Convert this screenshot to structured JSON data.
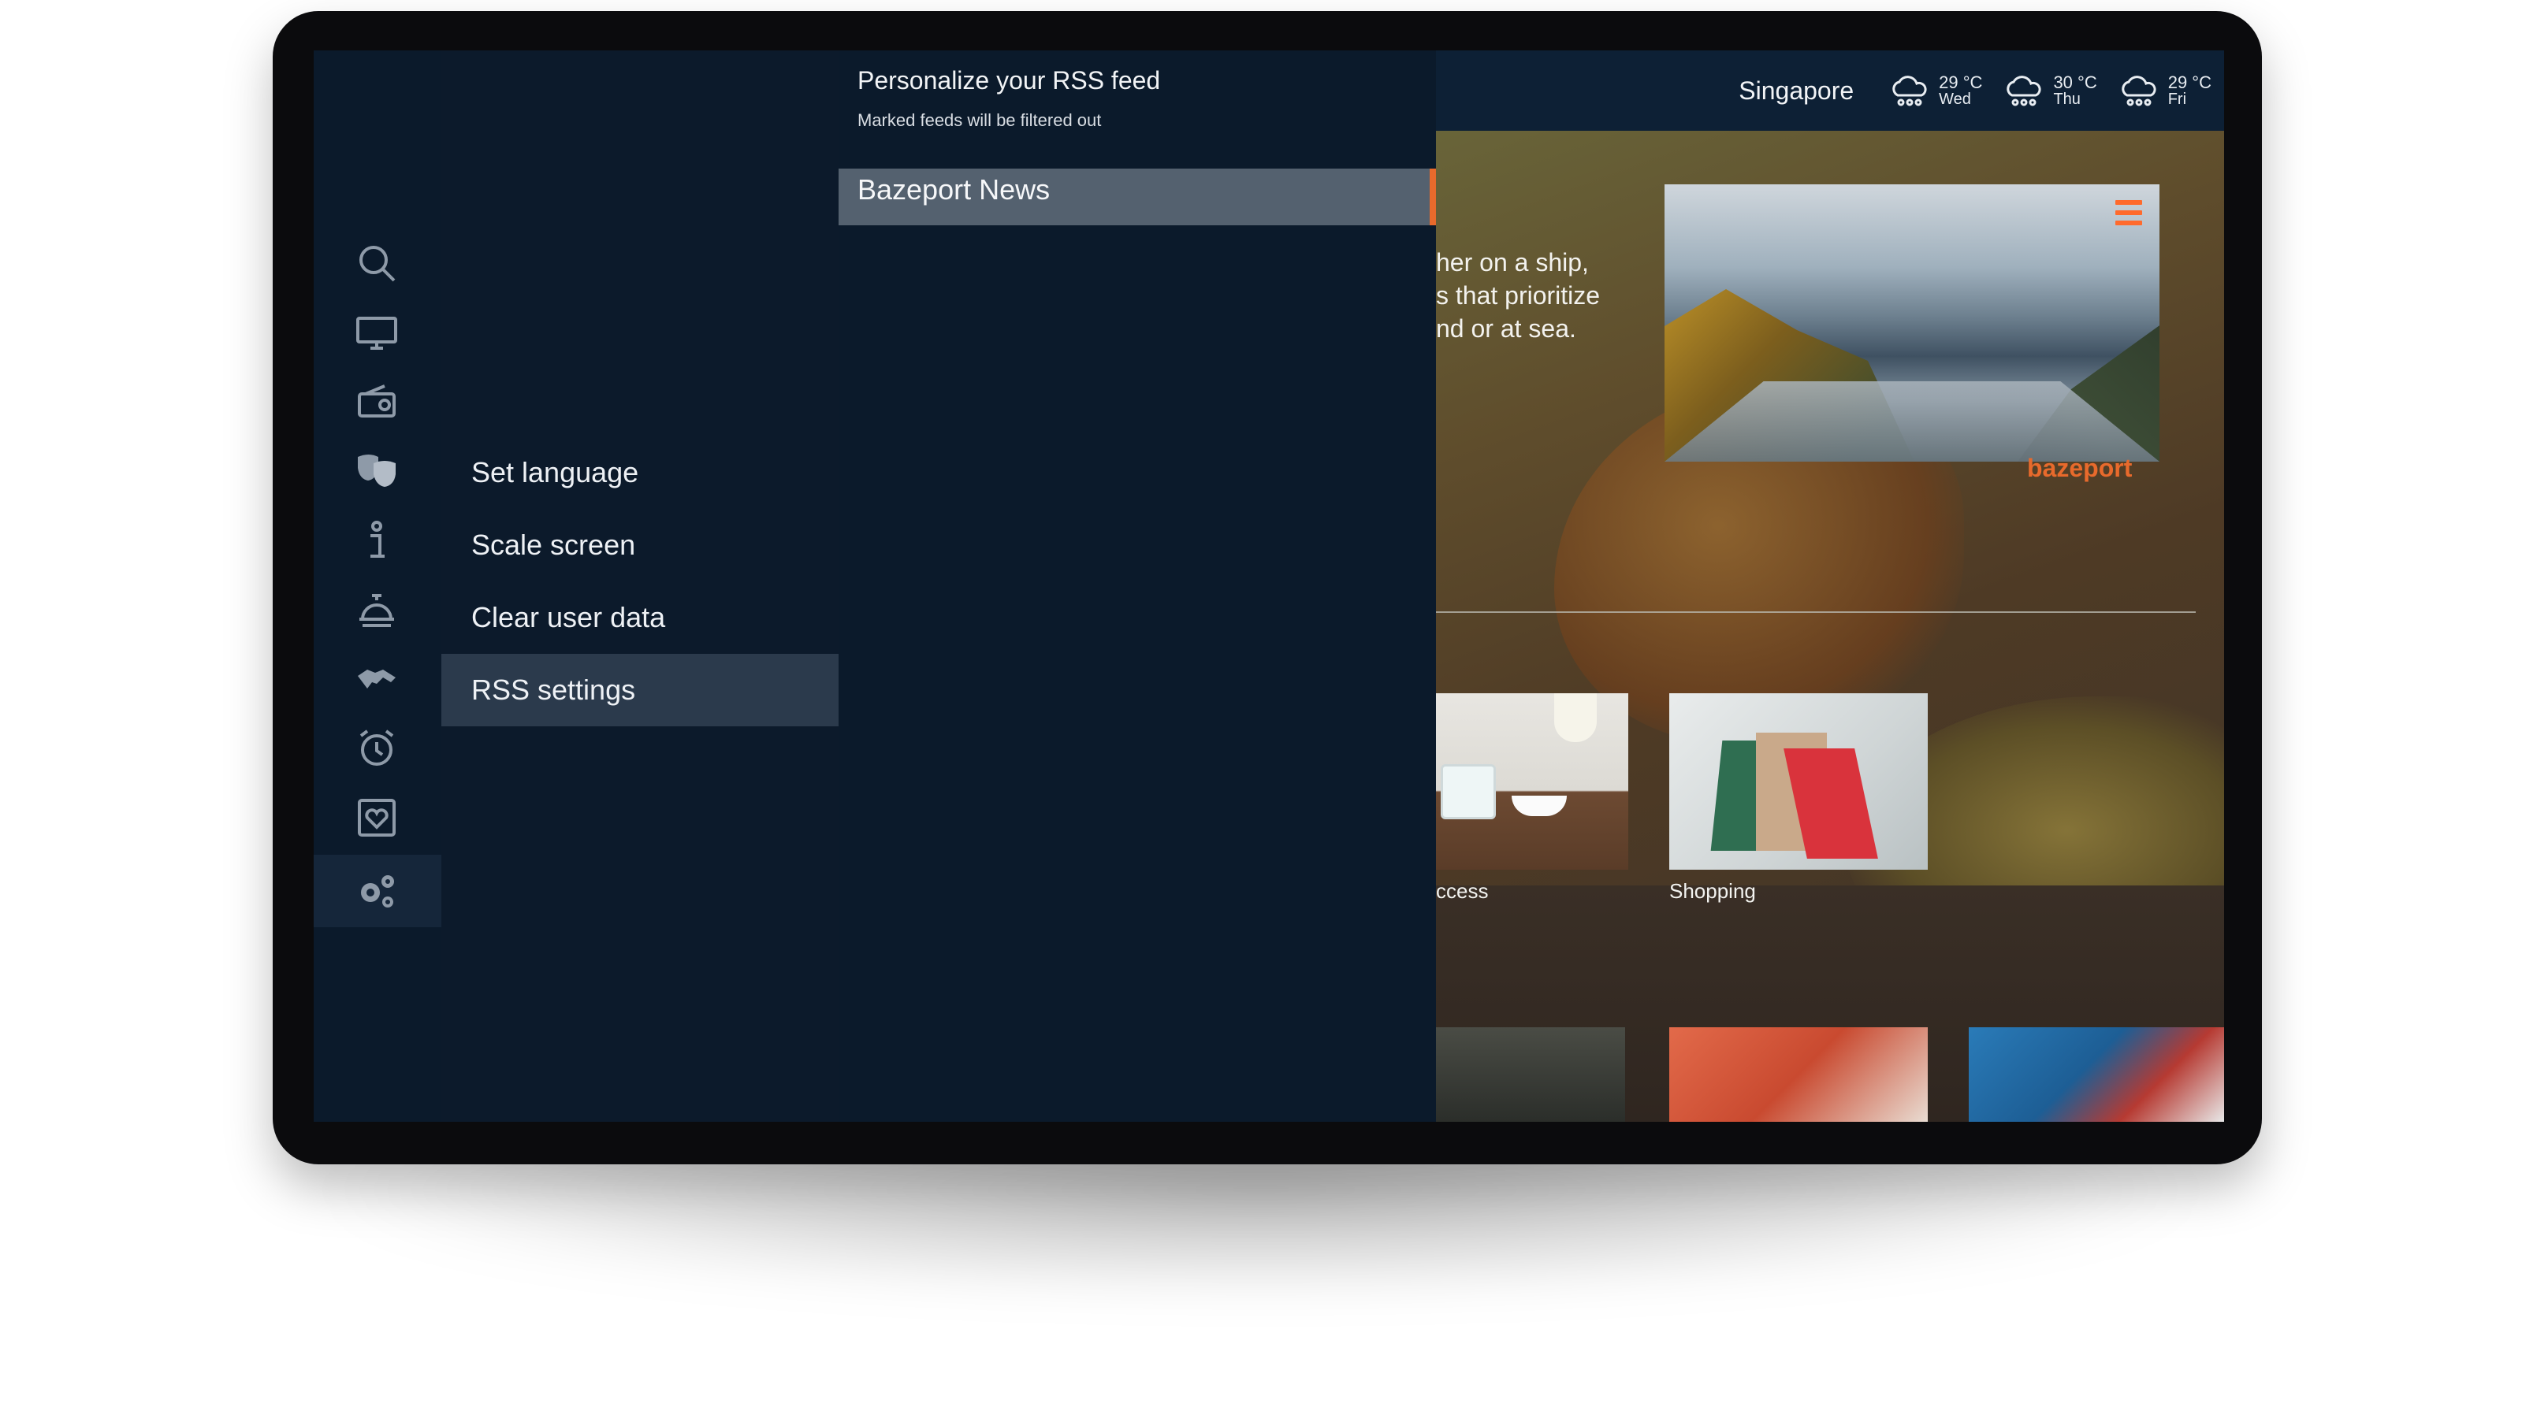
{
  "weather": {
    "city": "Singapore",
    "forecast": [
      {
        "temp": "29 °C",
        "day": "Wed",
        "icon": "rain-cloud-icon"
      },
      {
        "temp": "30 °C",
        "day": "Thu",
        "icon": "rain-cloud-icon"
      },
      {
        "temp": "29 °C",
        "day": "Fri",
        "icon": "rain-cloud-icon"
      }
    ]
  },
  "sidebar": {
    "icons": [
      "search-icon",
      "tv-icon",
      "radio-icon",
      "theater-masks-icon",
      "info-icon",
      "room-service-icon",
      "handshake-icon",
      "alarm-clock-icon",
      "heart-frame-icon",
      "settings-gears-icon"
    ],
    "active": "settings-gears-icon"
  },
  "settings_menu": {
    "items": [
      {
        "label": "Set language"
      },
      {
        "label": "Scale screen"
      },
      {
        "label": "Clear user data"
      },
      {
        "label": "RSS settings"
      }
    ],
    "active_index": 3
  },
  "rss": {
    "title": "Personalize your RSS feed",
    "subtitle": "Marked feeds will be filtered out",
    "feeds": [
      {
        "label": "Bazeport News"
      }
    ]
  },
  "background": {
    "hero_text": "her on a ship,\ns that prioritize\nnd or at sea.",
    "brand": "bazeport",
    "tiles": [
      {
        "label": "ccess"
      },
      {
        "label": "Shopping"
      }
    ]
  },
  "colors": {
    "accent": "#e86a2c",
    "panel": "#0b1a2b",
    "active_item": "#2b3a4c",
    "rss_item": "#54616f"
  }
}
